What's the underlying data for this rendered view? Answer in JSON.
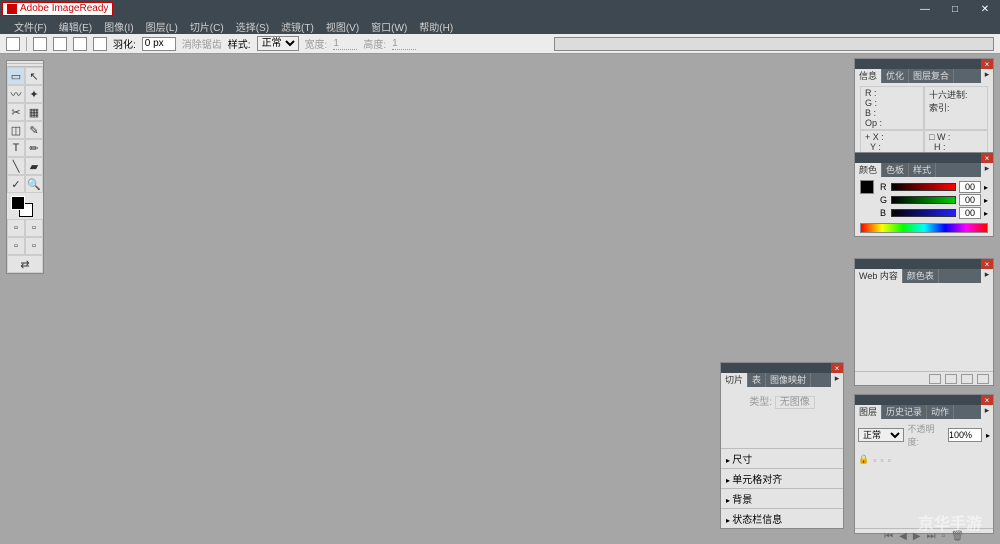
{
  "app_title": "Adobe ImageReady",
  "menu": [
    "文件(F)",
    "编辑(E)",
    "图像(I)",
    "图层(L)",
    "切片(C)",
    "选择(S)",
    "滤镜(T)",
    "视图(V)",
    "窗口(W)",
    "帮助(H)"
  ],
  "optbar": {
    "feather_label": "羽化:",
    "feather_value": "0 px",
    "antialias": "消除锯齿",
    "style_label": "样式:",
    "style_value": "正常",
    "width_label": "宽度:",
    "width_value": "1",
    "height_label": "高度:",
    "height_value": "1"
  },
  "info_panel": {
    "tabs": [
      "信息",
      "优化",
      "图层复合"
    ],
    "rows": {
      "r": "R :",
      "g": "G :",
      "b": "B :",
      "op": "Op :",
      "hex_label": "十六进制:",
      "index_label": "索引:",
      "x": "X :",
      "y": "Y :",
      "w": "W :",
      "h": "H :"
    }
  },
  "color_panel": {
    "tabs": [
      "颜色",
      "色板",
      "样式"
    ],
    "channels": [
      "R",
      "G",
      "B"
    ],
    "value": "00"
  },
  "web_panel": {
    "tabs": [
      "Web 内容",
      "颜色表"
    ]
  },
  "slice_panel": {
    "tabs": [
      "切片",
      "表",
      "图像映射"
    ],
    "type_label": "类型:",
    "type_value": "无图像",
    "sections": [
      "尺寸",
      "单元格对齐",
      "背景",
      "状态栏信息"
    ]
  },
  "layers_panel": {
    "tabs": [
      "图层",
      "历史记录",
      "动作"
    ],
    "blend": "正常",
    "opacity_label": "不透明度:",
    "opacity_value": "100%"
  },
  "watermark": "京华手游"
}
